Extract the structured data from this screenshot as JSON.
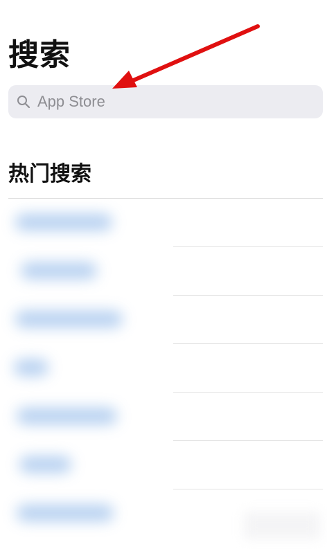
{
  "header": {
    "title": "搜索"
  },
  "search": {
    "placeholder": "App Store",
    "icon": "search-icon"
  },
  "trending": {
    "title": "热门搜索",
    "item_count_visible": 7
  },
  "colors": {
    "annotation_arrow": "#e01010",
    "search_bg": "#ececf1",
    "blurred_link": "#a9c8ee"
  }
}
